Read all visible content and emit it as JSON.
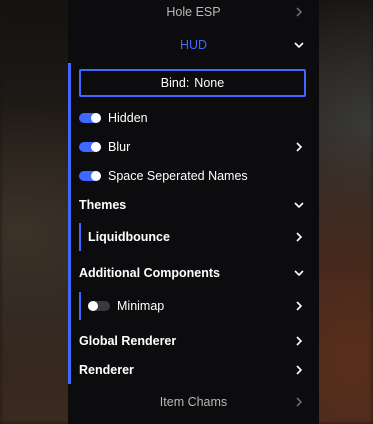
{
  "colors": {
    "accent": "#3f68ff",
    "panel_bg": "#0c0c0e",
    "text": "#ffffff",
    "dim_text": "#b8b8b8",
    "toggle_off": "#3a3a3e"
  },
  "menu": {
    "hole_esp": {
      "label": "Hole ESP",
      "icon": "chevron-right-icon"
    },
    "hud": {
      "label": "HUD",
      "icon": "chevron-down-icon",
      "bind": {
        "label": "Bind:",
        "value": "None"
      },
      "hidden": {
        "label": "Hidden",
        "enabled": true
      },
      "blur": {
        "label": "Blur",
        "enabled": true,
        "icon": "chevron-right-icon"
      },
      "space_names": {
        "label": "Space Seperated Names",
        "enabled": true
      },
      "themes": {
        "label": "Themes",
        "icon": "chevron-down-icon",
        "selected": {
          "label": "Liquidbounce",
          "icon": "chevron-right-icon"
        }
      },
      "additional_components": {
        "label": "Additional Components",
        "icon": "chevron-down-icon",
        "minimap": {
          "label": "Minimap",
          "enabled": false,
          "icon": "chevron-right-icon"
        }
      },
      "global_renderer": {
        "label": "Global Renderer",
        "icon": "chevron-right-icon"
      },
      "renderer": {
        "label": "Renderer",
        "icon": "chevron-right-icon"
      }
    },
    "item_chams": {
      "label": "Item Chams",
      "icon": "chevron-right-icon"
    }
  }
}
